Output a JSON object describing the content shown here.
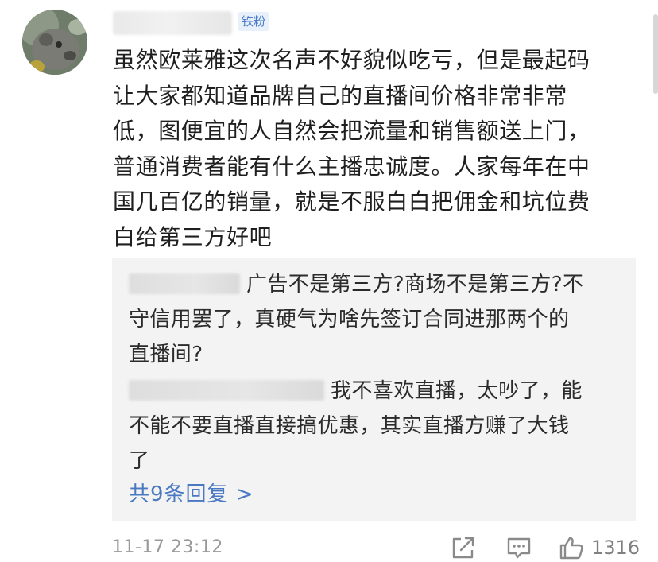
{
  "comment": {
    "badge": "铁粉",
    "lines": [
      "虽然欧莱雅这次名声不好貌似吃亏，但是最起码",
      "让大家都知道品牌自己的直播间价格非常非常",
      "低，图便宜的人自然会把流量和销售额送上门，",
      "普通消费者能有什么主播忠诚度。人家每年在中",
      "国几百亿的销量，就是不服白白把佣金和坑位费",
      "白给第三方好吧"
    ]
  },
  "replies": [
    {
      "lines": [
        "广告不是第三方?商场不是第三方?不",
        "守信用罢了，真硬气为啥先签订合同进那两个的",
        "直播间?"
      ]
    },
    {
      "lines": [
        "我不喜欢直播，太吵了，能",
        "不能不要直播直接搞优惠，其实直播方赚了大钱",
        "了"
      ]
    }
  ],
  "more_replies": "共9条回复 >",
  "footer": {
    "timestamp": "11-17 23:12",
    "like_count": "1316",
    "icons": [
      "share-icon",
      "comment-icon",
      "like-icon"
    ]
  },
  "colors": {
    "link": "#4a78c2",
    "badge_text": "#4a7cc6",
    "badge_bg": "#e8f0fb",
    "reply_bg": "#f3f3f3",
    "muted": "#9a9a9a"
  }
}
